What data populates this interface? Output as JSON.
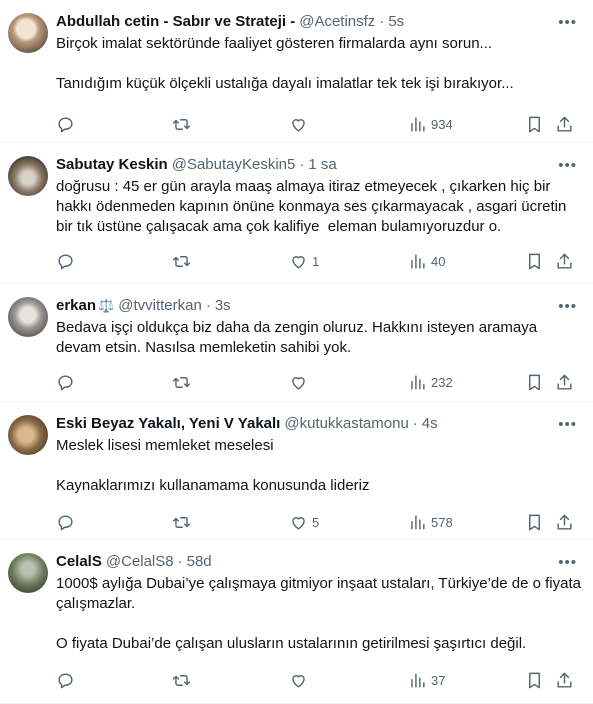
{
  "colors": {
    "text": "#0f1419",
    "muted": "#536471",
    "divider": "#eff3f4"
  },
  "icons": {
    "reply": "reply-icon",
    "retweet": "retweet-icon",
    "like": "heart-icon",
    "views": "views-icon",
    "bookmark": "bookmark-icon",
    "share": "share-icon",
    "more": "more-icon"
  },
  "tweets": [
    {
      "name": "Abdullah cetin - Sabır ve Strateji -",
      "handle": "@Acetinsfz",
      "time": "5s",
      "text": "Birçok imalat sektöründe faaliyet gösteren firmalarda aynı sorun...\n\nTanıdığım küçük ölçekli ustalığa dayalı imalatlar tek tek işi bırakıyor...",
      "likes": "",
      "views": "934"
    },
    {
      "name": "Sabutay Keskin",
      "handle": "@SabutayKeskin5",
      "time": "1 sa",
      "text": "doğrusu : 45 er gün arayla maaş almaya itiraz etmeyecek , çıkarken hiç bir hakkı ödenmeden kapının önüne konmaya ses çıkarmayacak , asgari ücretin bir tık üstüne çalışacak ama çok kalifiye  eleman bulamıyoruzdur o.",
      "likes": "1",
      "views": "40"
    },
    {
      "name": "erkan",
      "badge": "⚖️",
      "handle": "@tvvitterkan",
      "time": "3s",
      "text": "Bedava işçi oldukça biz daha da zengin oluruz. Hakkını isteyen aramaya devam etsin. Nasılsa memleketin sahibi yok.",
      "likes": "",
      "views": "232"
    },
    {
      "name": "Eski Beyaz Yakalı, Yeni V Yakalı",
      "handle": "@kutukkastamonu",
      "time": "4s",
      "text": "Meslek lisesi memleket meselesi\n\nKaynaklarımızı kullanamama konusunda lideriz",
      "likes": "5",
      "views": "578"
    },
    {
      "name": "CelalS",
      "handle": "@CelalS8",
      "time": "58d",
      "text": "1000$ aylığa Dubai’ye çalışmaya gitmiyor inşaat ustaları, Türkiye’de de o fiyata çalışmazlar.\n\nO fiyata Dubai’de çalışan ulusların ustalarının getirilmesi şaşırtıcı değil.",
      "likes": "",
      "views": "37"
    }
  ]
}
